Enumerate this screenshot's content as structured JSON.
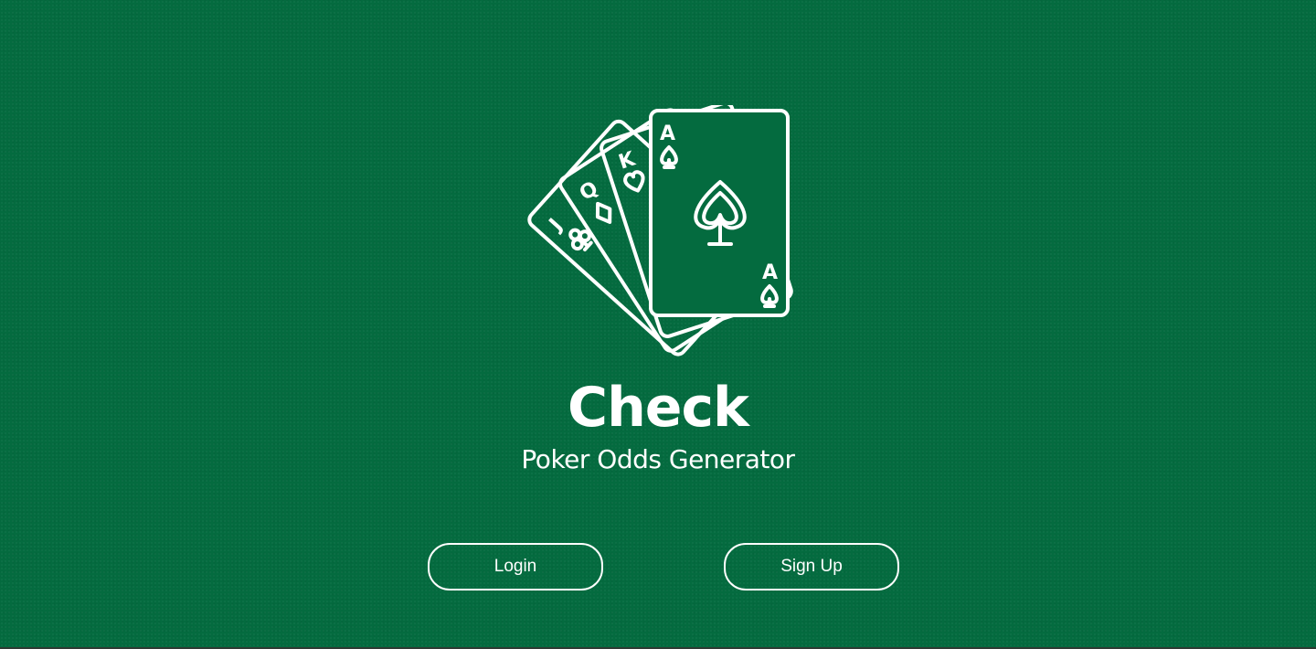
{
  "app": {
    "title": "Check",
    "subtitle": "Poker Odds Generator"
  },
  "logo": {
    "icon": "playing-cards-icon",
    "cards": [
      {
        "rank": "J",
        "suit": "clubs"
      },
      {
        "rank": "Q",
        "suit": "diamonds"
      },
      {
        "rank": "K",
        "suit": "hearts"
      },
      {
        "rank": "A",
        "suit": "spades"
      }
    ]
  },
  "actions": {
    "login_label": "Login",
    "signup_label": "Sign Up"
  },
  "colors": {
    "background": "#046b3f",
    "foreground": "#ffffff"
  }
}
